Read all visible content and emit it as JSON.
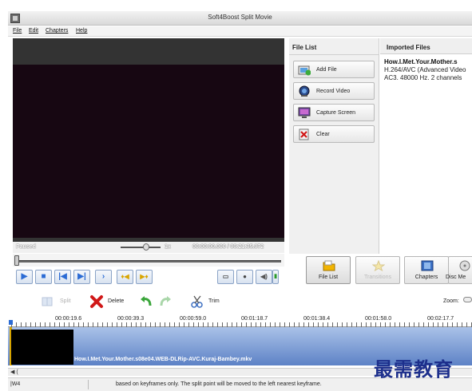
{
  "window": {
    "title": "Soft4Boost Split Movie"
  },
  "menu": [
    "File",
    "Edit",
    "Chapters",
    "Help"
  ],
  "player": {
    "status": "Paused",
    "speed": "1x",
    "time": "00:00:00.000 / 00:21:35.072",
    "position_fraction": 0.0
  },
  "file_list": {
    "header": "File List",
    "buttons": [
      "Add File",
      "Record Video",
      "Capture Screen",
      "Clear"
    ]
  },
  "imported_files": {
    "header": "Imported Files",
    "item": {
      "name": "How.I.Met.Your.Mother.s",
      "codec": "H.264/AVC (Advanced Video",
      "audio": "AC3. 48000 Hz. 2 channels"
    }
  },
  "tabs": [
    "File List",
    "Transitions",
    "Chapters",
    "Disc Me"
  ],
  "edit_toolbar": {
    "split": "Split",
    "delete": "Delete",
    "trim": "Trim",
    "zoom": "Zoom:"
  },
  "timeline": {
    "ticks": [
      "00:00:19.6",
      "00:00:39.3",
      "00:00:59.0",
      "00:01:18.7",
      "00:01:38.4",
      "00:01:58.0",
      "00:02:17.7"
    ],
    "clip_name": "How.I.Met.Your.Mother.s08e04.WEB-DLRip-AVC.Kuraj-Bambey.mkv"
  },
  "statusbar": {
    "cell1": "|W4",
    "message": "based on keyframes only. The split point will be moved to the left nearest keyframe."
  },
  "watermark": "最需教育",
  "colors": {
    "video_bg": "#170712",
    "timeline_track": "#5d82c6",
    "accent_blue": "#2b6bd4",
    "delete_red": "#d01818",
    "undo_green": "#3aa53a"
  }
}
